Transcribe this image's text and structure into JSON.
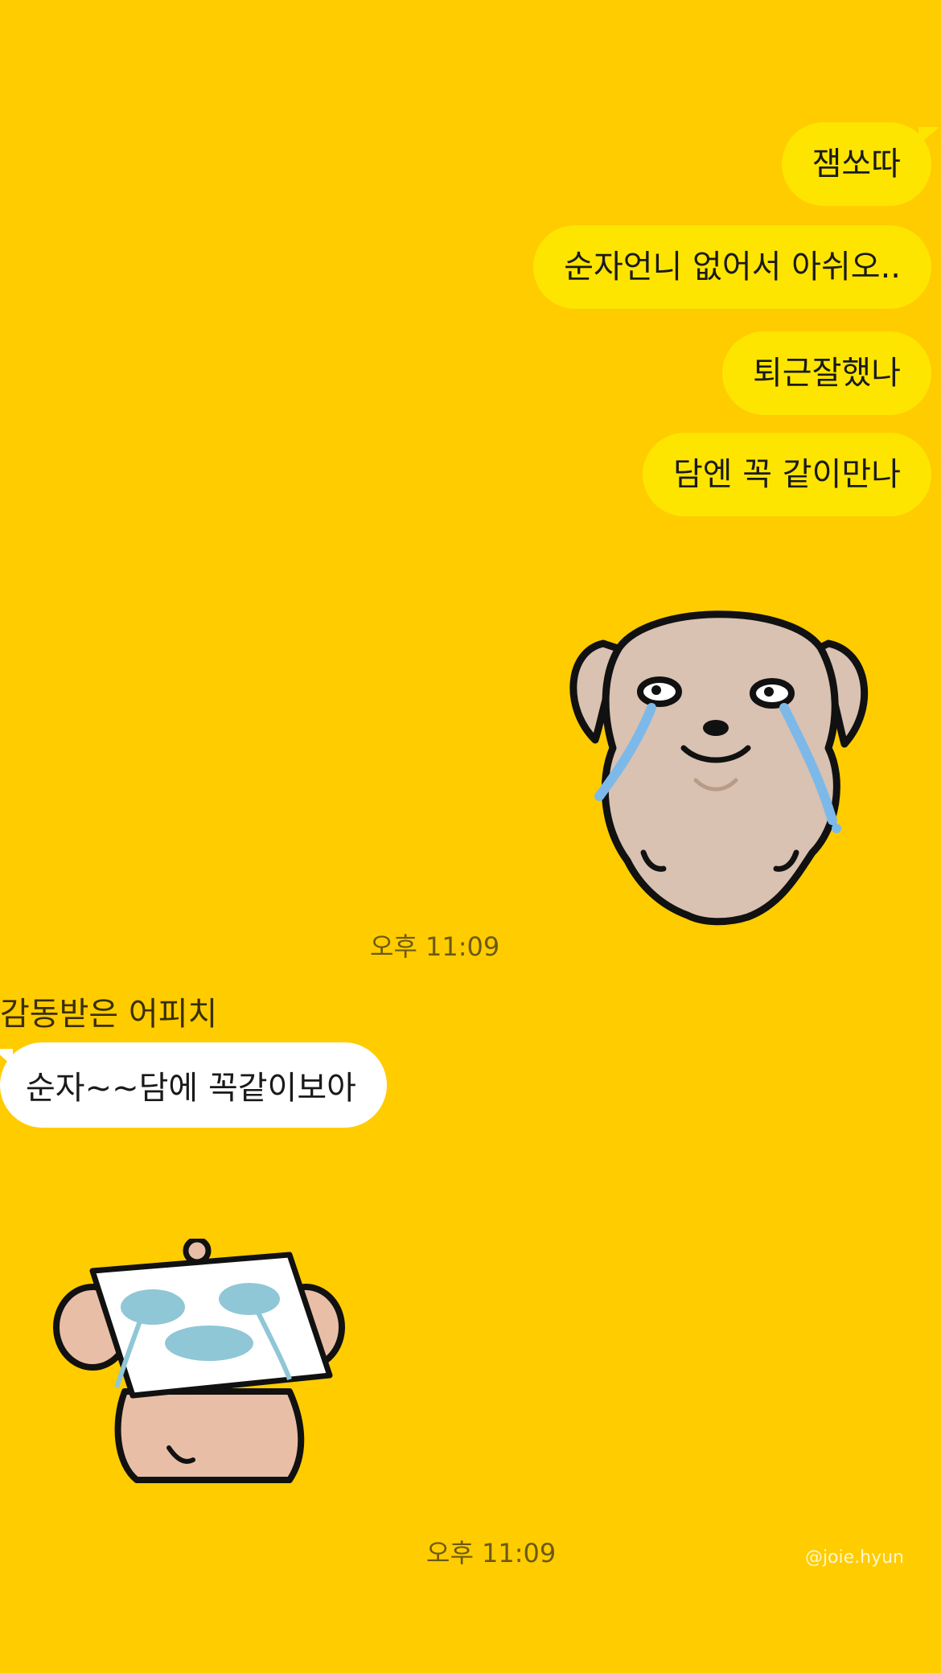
{
  "outgoing_messages": [
    {
      "text": "잼쏘따"
    },
    {
      "text": "순자언니 없어서 아쉬오.."
    },
    {
      "text": "퇴근잘했나"
    },
    {
      "text": "담엔 꼭 같이만나"
    }
  ],
  "outgoing_sticker": {
    "icon": "crying-puppy-sticker"
  },
  "timestamp_1": "오후 11:09",
  "incoming": {
    "sender": "감동받은 어피치",
    "message": "순자~~담에 꼭같이보아",
    "sticker_icon": "puppy-with-paper-on-face-sticker"
  },
  "timestamp_2": "오후 11:09",
  "watermark": "@joie.hyun",
  "colors": {
    "background": "#FFCC00",
    "outgoing_bubble": "#FEE500",
    "incoming_bubble": "#FFFFFF"
  }
}
